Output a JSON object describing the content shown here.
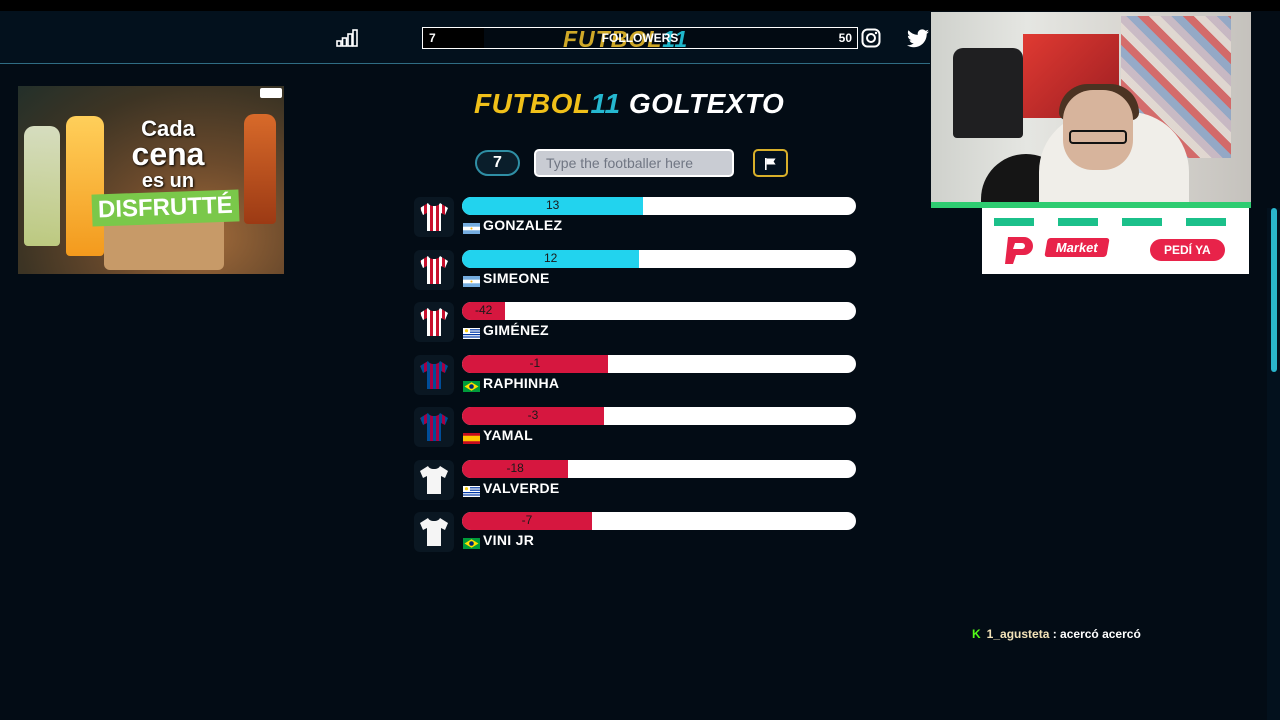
{
  "header": {
    "followers_current": "7",
    "followers_goal": "50",
    "followers_label": "FOLLOWERS",
    "followers_progress": 0.14,
    "logo_part1": "FUTBOL",
    "logo_part2": "11",
    "icons": [
      "stats-icon",
      "instagram-icon",
      "twitter-icon"
    ]
  },
  "ad": {
    "line1": "Cada",
    "line2": "cena",
    "line3": "es un",
    "line4": "DISFRUTTÉ"
  },
  "game": {
    "title_part1": "FUTBOL",
    "title_part2": "11",
    "title_part3": " GOLTEXTO",
    "tries": "7",
    "input_placeholder": "Type the footballer here",
    "guesses": [
      {
        "name": "GONZALEZ",
        "value": "13",
        "fill": 0.46,
        "color": "#22d3ee",
        "shirt": "atletico",
        "flag": "argentina"
      },
      {
        "name": "SIMEONE",
        "value": "12",
        "fill": 0.45,
        "color": "#22d3ee",
        "shirt": "atletico",
        "flag": "argentina"
      },
      {
        "name": "GIMÉNEZ",
        "value": "-42",
        "fill": 0.11,
        "color": "#d6173f",
        "shirt": "atletico",
        "flag": "uruguay"
      },
      {
        "name": "RAPHINHA",
        "value": "-1",
        "fill": 0.37,
        "color": "#d6173f",
        "shirt": "barcelona",
        "flag": "brazil"
      },
      {
        "name": "YAMAL",
        "value": "-3",
        "fill": 0.36,
        "color": "#d6173f",
        "shirt": "barcelona",
        "flag": "spain"
      },
      {
        "name": "VALVERDE",
        "value": "-18",
        "fill": 0.27,
        "color": "#d6173f",
        "shirt": "realmadrid",
        "flag": "uruguay"
      },
      {
        "name": "VINI JR",
        "value": "-7",
        "fill": 0.33,
        "color": "#d6173f",
        "shirt": "realmadrid",
        "flag": "brazil"
      }
    ]
  },
  "sponsor": {
    "brand": "Market",
    "cta": "PEDÍ YA"
  },
  "chat": {
    "badge": "K",
    "user": "1_agusteta",
    "separator": " : ",
    "message": "acercó acercó"
  }
}
